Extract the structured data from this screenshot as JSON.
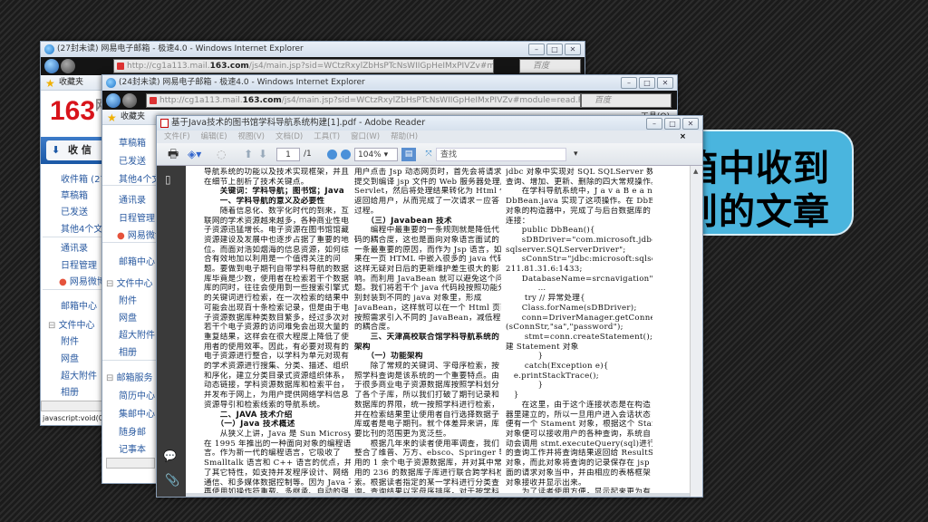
{
  "callout": {
    "line1": "箱中收到",
    "line2": "到的文章",
    "color": "#4ab5de"
  },
  "window1": {
    "title": "(27封未读) 网易电子邮箱 - 极速4.0 - Windows Internet Explorer",
    "url_prefix": "http://cg1a113.mail.",
    "url_domain": "163.com",
    "url_suffix": "/js4/main.jsp?sid=WCtzRxylZbHsPTcNsWIIGpHeIMxPIVZv#module=mbox.ListMoc",
    "search_placeholder": "百度",
    "favorites": "收藏夹",
    "logo": "163",
    "logo_suffix": "网",
    "receive_button": "收 信",
    "sidebar": [
      "收件箱 (27",
      "草稿箱",
      "已发送",
      "其他4个文件",
      "通讯录",
      "日程管理",
      "网易微博",
      "邮箱中心",
      "文件中心",
      "附件",
      "网盘",
      "超大附件",
      "相册"
    ],
    "status": "javascript:void(0)"
  },
  "window2": {
    "title": "(24封未读) 网易电子邮箱 - 极速4.0 - Windows Internet Explorer",
    "url_prefix": "http://cg1a113.mail.",
    "url_domain": "163.com",
    "url_suffix": "/js4/main.jsp?sid=WCtzRxylZbHsPTcNsWIIGpHeIMxPIVZv#module=read.ReadMoc",
    "search_placeholder": "百度",
    "favorites": "收藏夹",
    "tools_label": "工具(O)",
    "sidebar": [
      "草稿箱",
      "已发送",
      "其他4个文",
      "通讯录",
      "日程管理",
      "网易微博",
      "邮箱中心",
      "文件中心",
      "附件",
      "网盘",
      "超大附件",
      "相册",
      "邮箱服务",
      "简历中心",
      "集邮中心",
      "随身邮",
      "记事本"
    ]
  },
  "pdf": {
    "title": "基于Java技术的图书馆学科导航系统构建[1].pdf - Adobe Reader",
    "menu": [
      "文件(F)",
      "编辑(E)",
      "视图(V)",
      "文档(D)",
      "工具(T)",
      "窗口(W)",
      "帮助(H)"
    ],
    "page_current": "1",
    "page_total": "/1",
    "zoom": "104%",
    "find_placeholder": "查找",
    "columns": [
      [
        "导航系统的功能以及技术实现框架，并且",
        "在细节上剖析了技术关键点。",
        "　　关键词：学科导航；图书馆；Java",
        "　　一、学科导航的意义及必要性",
        "　　随着信息化、数字化时代的到来，互",
        "联网的学术资源越来越多，各种商业性电",
        "子资源迅猛增长。电子资源在图书馆馆藏",
        "资源建设及发展中也逐步占据了重要的地",
        "位。而面对浩如烟海的信息资源，如何综",
        "合有效地加以利用是一个值得关注的问",
        "题。要做到电子期刊自带学科导航的数据",
        "库毕竟是少数，使用者在检索若干个数据",
        "库的同时，往往会使用到一些搜索引擎式",
        "的关键词进行检索，在一次检索的结果中",
        "可能会出现百十条检索记录，但是由于电",
        "子资源数据库种类数目繁多，经过多次对",
        "若干个电子资源的访问难免会出现大量的",
        "重复结果，这样会在很大程度上降低了使",
        "用者的使用效率。因此，有必要对现有的",
        "电子资源进行整合，以学科为单元对现有",
        "的学术资源进行搜集、分类、描述、组织",
        "和序化，建立分类目录式资源组织体系，",
        "动态链接，学科资源数据库和检索平台，",
        "并发布于网上，为用户提供网络学科信息",
        "资源导引和检索线索的导航系统。",
        "　　二、JAVA 技术介绍",
        "　　（一）Java 技术概述",
        "　　从狭义上讲，Java 是 Sun Microsystem",
        "在 1995 年推出的一种面向对象的编程语",
        "言。作为新一代的编程语言，它吸收了",
        "Smalltalk 语言和 C++ 语言的优点，并增加",
        "了其它特性，如支持并发程序设计、网络",
        "通信、和多媒体数据控制等。因为 Java 不",
        "再使用如操作符重载、多继承、自动的强"
      ],
      [
        "用户点击 Jsp 动态网页时，首先会将请求",
        "提交到编译 jsp 文件的 Web 服务器处理成",
        "Servlet，然后将处理结果转化为 Html 代码",
        "返回给用户，从而完成了一次请求－应答",
        "过程。",
        "　　（三）Javabean 技术",
        "　　编程中最重要的一条规则就是降低代",
        "码的耦合度，这也是面向对象语言面试的",
        "一条最重要的原因，而作为 Jsp 语言，如",
        "果在一页 HTML 中嵌入很多的 java 代码，",
        "这样无疑对日后的更新维护差生很大的影",
        "响。而利用 JavaBean 就可以避免这个问",
        "题。我们将若干个 java 代码段按照功能分",
        "别封装到不同的 java 对象里，形成",
        "JavaBean，这样就可以在一个 Html 页面中",
        "按照需求引入不同的 JavaBean，减低程序",
        "的耦合度。",
        "　　三、天津高校联合馆学科导航系统的",
        "架构",
        "　　（一）功能架构",
        "　　除了常规的关键词、字母序检索，按",
        "照学科查询是该系统的一个重要特点。由",
        "于很多商业电子资源数据库按照学科划分",
        "了各个子库，所以我们打破了期刊记录和",
        "数据库的界限，统一按照学科进行检索，",
        "并在检索结果里让使用者自行选择数据子",
        "库或者是电子期刊。就个体差异来讲，库",
        "要比刊的范围更为宽泛些。",
        "　　根据几年来的读者使用率调查，我们",
        "整合了维普、万方、ebsco、Springer 等常",
        "用的 1 余个电子资源数据库，并对其中常",
        "用的 236 的数据库子库进行联合跨学科检",
        "索。根据读者指定的某一学科进行分类查",
        "询。查询结果以字母序排序，对于按学科"
      ],
      [
        "jdbc 对象中实现对 SQL SQLServer 数据库",
        "查询、增加、更新、删除的四大常规操作。",
        "　　在学科导航系统中，J a v a B e a n",
        "DbBean.java 实现了这项操作。在 DbBean",
        "对象的构造器中，完成了与后台数据库的",
        "连接：",
        "　　public DbBean(){",
        "　　sDBDriver=\"com.microsoft.jdbc.",
        "sqlserver.SQLServerDriver\";",
        "　　sConnStr=\"jdbc:microsoft:sqlserver://",
        "211.81.31.6:1433;",
        "　　DatabaseName=srcnavigation\";",
        "　　　　…",
        "　　 try // 异常处理{",
        "　　Class.forName(sDBDriver);",
        "　　conn=DriverManager.getConnection",
        "(sConnStr,\"sa\",\"password\");",
        "　　 stmt=conn.createStatement(); // 创",
        "建 Statement 对象",
        "　　　　}",
        "　　 catch(Exception e){",
        "　e.printStackTrace();",
        "　　　　}",
        "　}",
        "　　在这里，由于这个连接状态是在构造",
        "器里建立的，所以一旦用户进入会话状态",
        "便有一个 Stament 对象，根据这个 Stament",
        "对象便可以接收用户的各种查询，系统自",
        "动会调用 stmt.executeQuery(sql)进行相应",
        "的查询工作并将查询结果返回给 ResultSet",
        "对象，而此对象将查询的记录保存在 jsp 页",
        "面的请求对象当中，并由相应的表格框架",
        "对象接收并显示出来。",
        "　　为了读者使用方便，显示起来更为有"
      ]
    ]
  }
}
